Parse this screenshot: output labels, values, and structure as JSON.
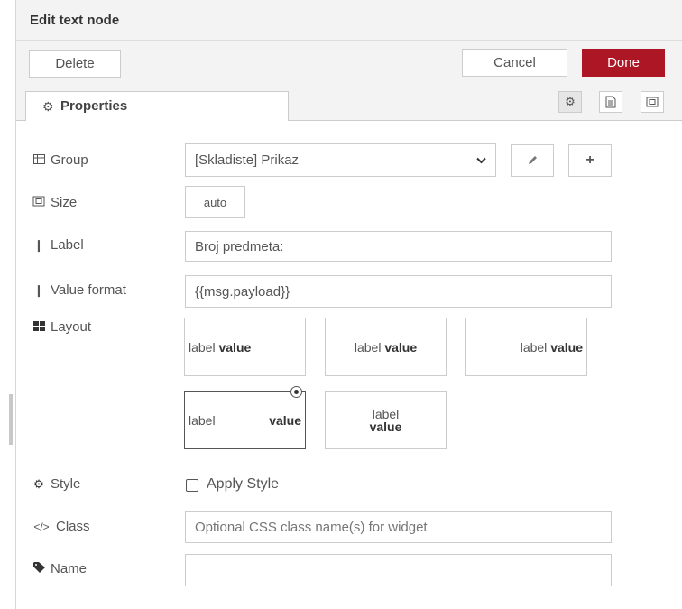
{
  "header": {
    "title": "Edit text node"
  },
  "toolbar": {
    "delete_label": "Delete",
    "cancel_label": "Cancel",
    "done_label": "Done"
  },
  "tabs": {
    "properties_label": "Properties"
  },
  "fields": {
    "group": {
      "label": "Group",
      "value": "[Skladiste] Prikaz"
    },
    "size": {
      "label": "Size",
      "value": "auto"
    },
    "label": {
      "label": "Label",
      "value": "Broj predmeta:"
    },
    "value_format": {
      "label": "Value format",
      "value": "{{msg.payload}}"
    },
    "layout": {
      "label": "Layout",
      "options": [
        {
          "label": "label",
          "value": "value"
        },
        {
          "label": "label",
          "value": "value"
        },
        {
          "label": "label",
          "value": "value"
        },
        {
          "label": "label",
          "value": "value"
        },
        {
          "label": "label",
          "value": "value"
        }
      ],
      "selected_index": 3
    },
    "style": {
      "label": "Style",
      "checkbox_label": "Apply Style"
    },
    "class": {
      "label": "Class",
      "placeholder": "Optional CSS class name(s) for widget",
      "value": ""
    },
    "name": {
      "label": "Name",
      "value": ""
    }
  },
  "icons": {
    "tab": "cog-icon",
    "tab_buttons": [
      "cog-icon",
      "file-text-icon",
      "size-icon"
    ],
    "group": "table-icon",
    "size": "size-icon",
    "label": "i-cursor-icon",
    "value_format": "i-cursor-icon",
    "layout": "th-large-icon",
    "style": "cog-icon",
    "class": "code-icon",
    "name": "tag-icon"
  },
  "colors": {
    "done_button": "#ad1625",
    "header_bg": "#f3f3f3"
  }
}
